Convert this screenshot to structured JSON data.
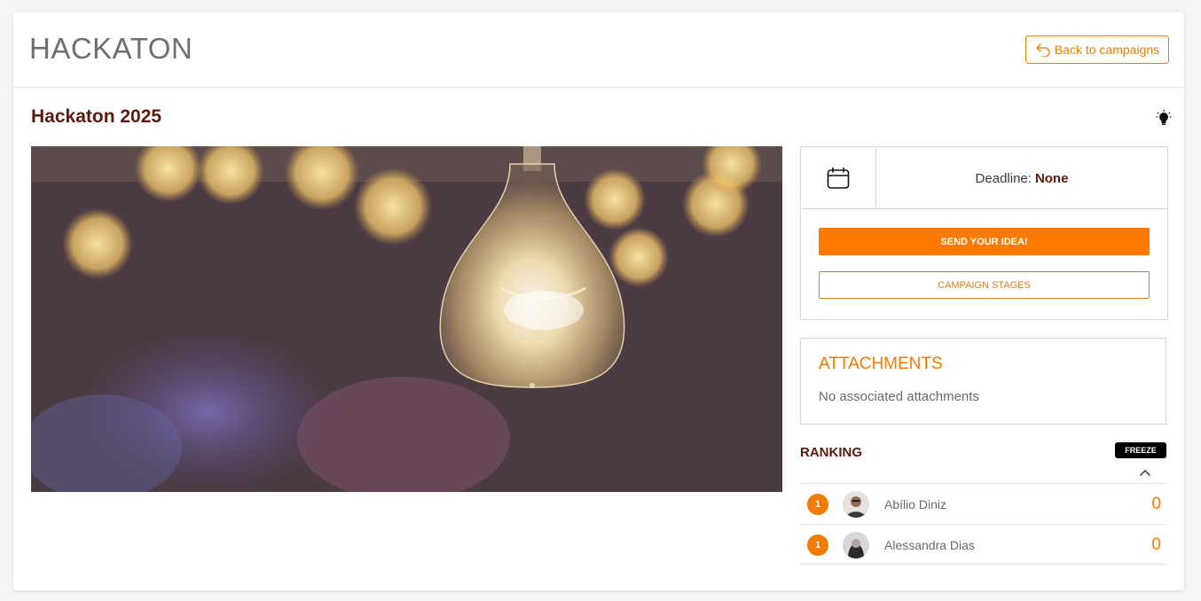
{
  "header": {
    "title": "HACKATON",
    "back_label": "Back to campaigns"
  },
  "campaign": {
    "title": "Hackaton 2025",
    "icon": "lightbulb-icon",
    "image_icon": "lightbulb-photo"
  },
  "deadline": {
    "label": "Deadline:",
    "value": "None",
    "icon": "calendar-icon"
  },
  "actions": {
    "send_label": "SEND YOUR IDEA!",
    "stages_label": "CAMPAIGN STAGES"
  },
  "attachments": {
    "title": "ATTACHMENTS",
    "empty_text": "No associated attachments"
  },
  "ranking": {
    "title": "RANKING",
    "freeze_label": "FREEZE",
    "rows": [
      {
        "position": "1",
        "name": "Abílio Diniz",
        "score": "0"
      },
      {
        "position": "1",
        "name": "Alessandra Dias",
        "score": "0"
      }
    ]
  },
  "colors": {
    "accent": "#ff7a00",
    "title_dark": "#5a1a12"
  }
}
